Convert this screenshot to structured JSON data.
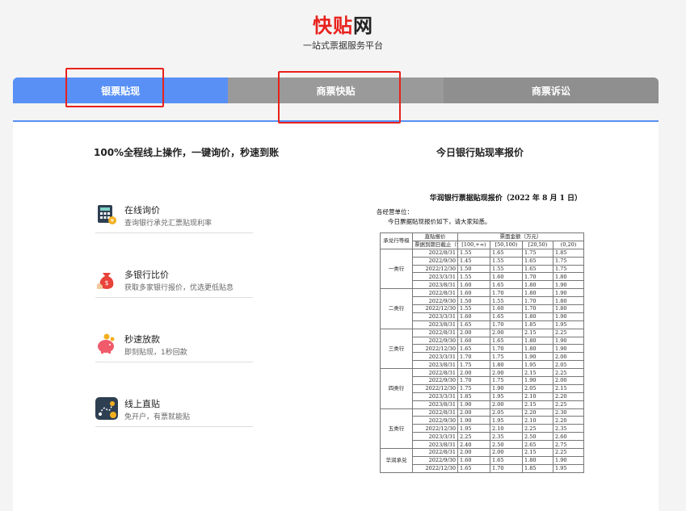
{
  "brand": {
    "part1": "快贴",
    "part2": "网",
    "slogan": "一站式票据服务平台"
  },
  "tabs": [
    {
      "label": "银票贴现",
      "active": true
    },
    {
      "label": "商票快贴",
      "active": false
    },
    {
      "label": "商票诉讼",
      "active": false
    }
  ],
  "left": {
    "title": "100%全程线上操作，一键询价，秒速到账",
    "features": [
      {
        "title": "在线询价",
        "desc": "查询银行承兑汇票贴现利率",
        "icon": "calculator-icon"
      },
      {
        "title": "多银行比价",
        "desc": "获取多家银行报价，优选更低贴息",
        "icon": "money-bag-icon"
      },
      {
        "title": "秒速放款",
        "desc": "即刻贴现，1秒回款",
        "icon": "piggy-bank-icon"
      },
      {
        "title": "线上直贴",
        "desc": "免开户，有票就能贴",
        "icon": "route-icon"
      }
    ]
  },
  "right": {
    "title": "今日银行贴现率报价",
    "notice_title": "华润银行票据贴现报价（2022 年 8 月 1 日）",
    "notice_line1": "各经营单位：",
    "notice_line2": "今日票据贴现报价如下，请大家知悉。",
    "table": {
      "h_grade": "承兑行等级",
      "h_direct": "直贴报价",
      "h_due": "票据到期日截止（含当日）",
      "h_amount": "票面金额（万元）",
      "h_ranges": [
        "[100,+∞)",
        "[50,100)",
        "[20,50)",
        "(0,20)"
      ],
      "groups": [
        {
          "name": "一类行",
          "rows": [
            [
              "2022/8/31",
              "1.55",
              "1.65",
              "1.75",
              "1.85"
            ],
            [
              "2022/9/30",
              "1.45",
              "1.55",
              "1.65",
              "1.75"
            ],
            [
              "2022/12/30",
              "1.50",
              "1.55",
              "1.65",
              "1.75"
            ],
            [
              "2023/3/31",
              "1.55",
              "1.60",
              "1.70",
              "1.80"
            ],
            [
              "2023/8/31",
              "1.60",
              "1.65",
              "1.80",
              "1.90"
            ]
          ]
        },
        {
          "name": "二类行",
          "rows": [
            [
              "2022/8/31",
              "1.60",
              "1.70",
              "1.80",
              "1.90"
            ],
            [
              "2022/9/30",
              "1.50",
              "1.55",
              "1.70",
              "1.80"
            ],
            [
              "2022/12/30",
              "1.55",
              "1.60",
              "1.70",
              "1.80"
            ],
            [
              "2023/3/31",
              "1.60",
              "1.65",
              "1.80",
              "1.90"
            ],
            [
              "2023/8/31",
              "1.65",
              "1.70",
              "1.85",
              "1.95"
            ]
          ]
        },
        {
          "name": "三类行",
          "rows": [
            [
              "2022/8/31",
              "2.00",
              "2.00",
              "2.15",
              "2.25"
            ],
            [
              "2022/9/30",
              "1.60",
              "1.65",
              "1.80",
              "1.90"
            ],
            [
              "2022/12/30",
              "1.65",
              "1.70",
              "1.80",
              "1.90"
            ],
            [
              "2023/3/31",
              "1.70",
              "1.75",
              "1.90",
              "2.00"
            ],
            [
              "2023/8/31",
              "1.75",
              "1.80",
              "1.95",
              "2.05"
            ]
          ]
        },
        {
          "name": "四类行",
          "rows": [
            [
              "2022/8/31",
              "2.00",
              "2.00",
              "2.15",
              "2.25"
            ],
            [
              "2022/9/30",
              "1.70",
              "1.75",
              "1.90",
              "2.00"
            ],
            [
              "2022/12/30",
              "1.75",
              "1.90",
              "2.05",
              "2.15"
            ],
            [
              "2023/3/31",
              "1.85",
              "1.95",
              "2.10",
              "2.20"
            ],
            [
              "2023/8/31",
              "1.90",
              "2.00",
              "2.15",
              "2.25"
            ]
          ]
        },
        {
          "name": "五类行",
          "rows": [
            [
              "2022/8/31",
              "2.00",
              "2.05",
              "2.20",
              "2.30"
            ],
            [
              "2022/9/30",
              "1.90",
              "1.95",
              "2.10",
              "2.20"
            ],
            [
              "2022/12/30",
              "1.95",
              "2.10",
              "2.25",
              "2.35"
            ],
            [
              "2023/3/31",
              "2.25",
              "2.35",
              "2.50",
              "2.60"
            ],
            [
              "2023/8/31",
              "2.40",
              "2.50",
              "2.65",
              "2.75"
            ]
          ]
        },
        {
          "name": "华润承兑",
          "rows": [
            [
              "2022/8/31",
              "2.00",
              "2.00",
              "2.15",
              "2.25"
            ],
            [
              "2022/9/30",
              "1.60",
              "1.65",
              "1.80",
              "1.90"
            ],
            [
              "2022/12/30",
              "1.65",
              "1.70",
              "1.85",
              "1.95"
            ]
          ]
        }
      ]
    }
  },
  "colors": {
    "brand_red": "#e8211c",
    "tab_active": "#5890f5",
    "tab_inactive": "#999999",
    "highlight": "#e8211c"
  }
}
